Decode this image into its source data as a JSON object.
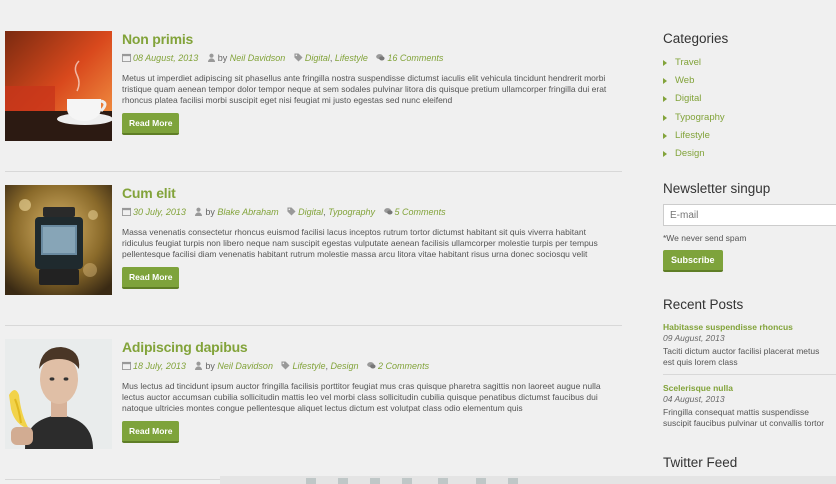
{
  "posts": [
    {
      "title": "Non primis",
      "date": "08 August, 2013",
      "by": "by",
      "author": "Neil Davidson",
      "tags": [
        "Digital",
        "Lifestyle"
      ],
      "comments": "16 Comments",
      "excerpt": "Metus ut imperdiet adipiscing sit phasellus ante fringilla nostra suspendisse dictumst iaculis elit vehicula tincidunt hendrerit morbi tristique quam aenean tempor dolor tempor neque at sem sodales pulvinar litora dis quisque pretium ullamcorper fringilla dui erat rhoncus platea facilisi morbi suscipit eget nisi feugiat mi justo egestas sed nunc eleifend",
      "read_more": "Read More"
    },
    {
      "title": "Cum elit",
      "date": "30 July, 2013",
      "by": "by",
      "author": "Blake Abraham",
      "tags": [
        "Digital",
        "Typography"
      ],
      "comments": "5 Comments",
      "excerpt": "Massa venenatis consectetur rhoncus euismod facilisi lacus inceptos rutrum tortor dictumst habitant sit quis viverra habitant ridiculus feugiat turpis non libero neque nam suscipit egestas vulputate aenean facilisis ullamcorper molestie turpis per tempus pellentesque facilisi diam venenatis habitant rutrum molestie massa arcu litora vitae habitant risus urna donec sociosqu velit",
      "read_more": "Read More"
    },
    {
      "title": "Adipiscing dapibus",
      "date": "18 July, 2013",
      "by": "by",
      "author": "Neil Davidson",
      "tags": [
        "Lifestyle",
        "Design"
      ],
      "comments": "2 Comments",
      "excerpt": "Mus lectus ad tincidunt ipsum auctor fringilla facilisis porttitor feugiat mus cras quisque pharetra sagittis non laoreet augue nulla lectus auctor accumsan cubilia sollicitudin mattis leo vel morbi class sollicitudin cubilia quisque penatibus dictumst faucibus dui natoque ultricies montes congue pellentesque aliquet lectus dictum est volutpat class odio elementum quis",
      "read_more": "Read More"
    }
  ],
  "sidebar": {
    "categories_title": "Categories",
    "categories": [
      "Travel",
      "Web",
      "Digital",
      "Typography",
      "Lifestyle",
      "Design"
    ],
    "newsletter_title": "Newsletter singup",
    "email_placeholder": "E-mail",
    "spam_note": "*We never send spam",
    "subscribe_label": "Subscribe",
    "recent_title": "Recent Posts",
    "recent": [
      {
        "title": "Habitasse suspendisse rhoncus",
        "date": "09 August, 2013",
        "excerpt": "Taciti dictum auctor facilisi placerat metus est quis lorem class"
      },
      {
        "title": "Scelerisque nulla",
        "date": "04 August, 2013",
        "excerpt": "Fringilla consequat mattis suspendisse suscipit faucibus pulvinar ut convallis tortor"
      }
    ],
    "twitter_title": "Twitter Feed"
  },
  "colors": {
    "accent": "#82a33a",
    "button": "#7ea33b",
    "background": "#f0f0f0"
  }
}
